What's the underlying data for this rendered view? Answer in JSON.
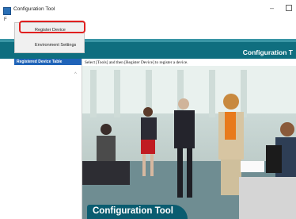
{
  "window": {
    "title": "Configuration Tool",
    "minimize_glyph": "–",
    "menu_first_letter": "F"
  },
  "dropdown": {
    "items": [
      "Register Device",
      "Environment Settings"
    ]
  },
  "header": {
    "title": "Configuration T"
  },
  "sidebar": {
    "title": "Registered Device Table",
    "scroll_glyph": "^"
  },
  "main": {
    "instruction": "Select [Tools] and then [Register Device] to register a device."
  },
  "footer": {
    "title": "Configuration Tool"
  },
  "colors": {
    "header_teal": "#0f6e7f",
    "sidebar_blue": "#1f63b8",
    "highlight_red": "#e02020"
  },
  "icons": [
    "app-icon",
    "minimize-icon",
    "maximize-icon"
  ]
}
